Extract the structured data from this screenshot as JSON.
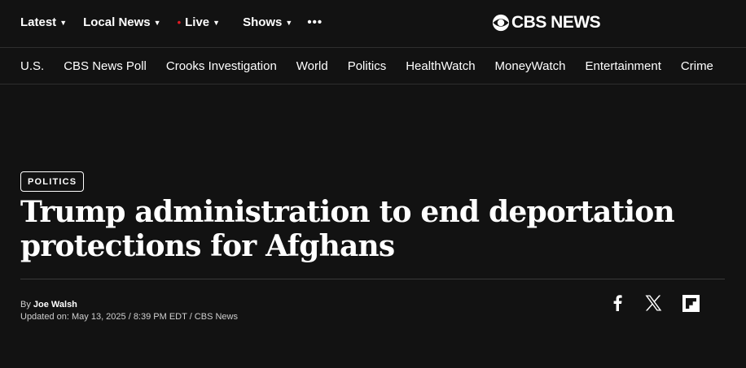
{
  "topnav": {
    "latest": "Latest",
    "local_news": "Local News",
    "live": "Live",
    "shows": "Shows",
    "more": "•••",
    "chevron": "⌄"
  },
  "logo": {
    "text": "CBS NEWS",
    "icon": "cbs-eye-icon"
  },
  "subnav": [
    "U.S.",
    "CBS News Poll",
    "Crooks Investigation",
    "World",
    "Politics",
    "HealthWatch",
    "MoneyWatch",
    "Entertainment",
    "Crime"
  ],
  "article": {
    "section_tag": "POLITICS",
    "headline": "Trump administration to end deportation protections for Afghans",
    "byline_prefix": "By",
    "author": "Joe Walsh",
    "updated": "Updated on: May 13, 2025 / 8:39 PM EDT / CBS News"
  },
  "share": {
    "icons": [
      "facebook-icon",
      "x-icon",
      "flipboard-icon"
    ]
  },
  "colors": {
    "background": "#121212",
    "live_dot": "#e31b23"
  }
}
